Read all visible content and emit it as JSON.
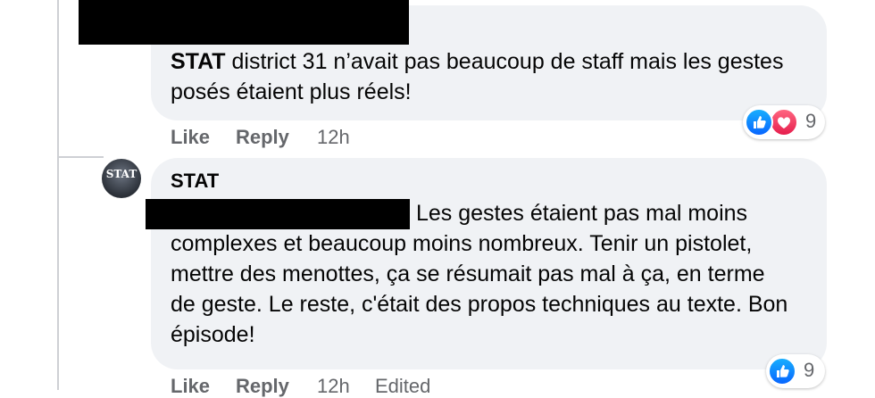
{
  "comment1": {
    "author": "STAT",
    "text": " district 31 n’avait pas beaucoup de staff mais les gestes posés étaient plus réels!",
    "actions": {
      "like": "Like",
      "reply": "Reply",
      "time": "12h"
    },
    "reaction_count": "9",
    "reaction_icons": [
      "like-icon",
      "love-icon"
    ]
  },
  "comment2": {
    "avatar_text": "STAT",
    "author": "STAT",
    "text_line1": "Les gestes étaient pas mal moins",
    "text_rest": "complexes et beaucoup moins nombreux. Tenir un pistolet, mettre des menottes, ça se résumait pas mal à ça, en terme de geste. Le reste, c'était des propos techniques au texte. Bon épisode!",
    "actions": {
      "like": "Like",
      "reply": "Reply",
      "time": "12h",
      "edited": "Edited"
    },
    "reaction_count": "9",
    "reaction_icons": [
      "like-icon"
    ]
  },
  "colors": {
    "bubble": "#f0f2f5",
    "meta": "#65676b",
    "like": "#0866ff",
    "love": "#e61e4d",
    "thread": "#ced0d4"
  }
}
